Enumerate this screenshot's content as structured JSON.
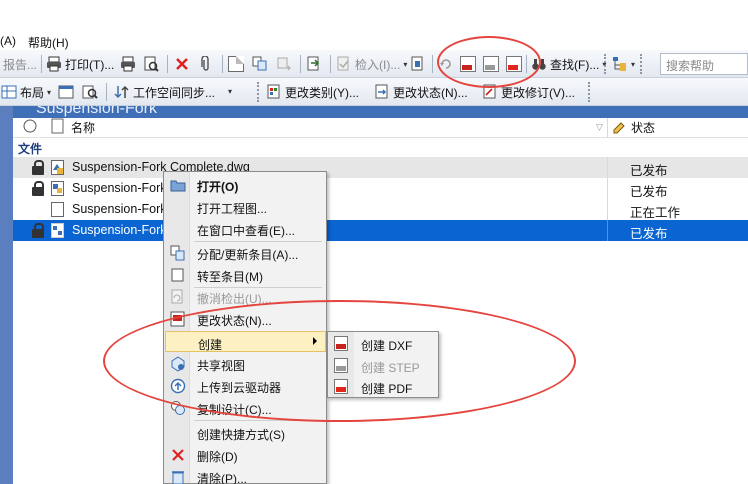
{
  "menubar": {
    "items": [
      "(A)",
      "帮助(H)"
    ]
  },
  "toolbar1": {
    "report_label": "报告...",
    "print_label": "打印(T)...",
    "checkin_label": "检入(I)...",
    "find_label": "查找(F)...",
    "search_placeholder": "搜索帮助"
  },
  "toolbar2": {
    "layout_label": "布局",
    "workspace_sync_label": "工作空间同步...",
    "change_category_label": "更改类别(Y)...",
    "change_state_label": "更改状态(N)...",
    "change_revision_label": "更改修订(V)..."
  },
  "title_strip_text": "Suspension-Fork",
  "columns": {
    "name": "名称",
    "state": "状态"
  },
  "group_label": "文件",
  "rows": [
    {
      "name": "Suspension-Fork Complete.dwg",
      "state": "已发布",
      "locked": true
    },
    {
      "name": "Suspension-Fork",
      "state": "已发布",
      "locked": true
    },
    {
      "name": "Suspension-Fork",
      "state": "正在工作",
      "locked": false
    },
    {
      "name": "Suspension-Fork",
      "state": "已发布",
      "locked": true
    }
  ],
  "context_menu": {
    "items": [
      {
        "label": "打开(O)"
      },
      {
        "label": "打开工程图..."
      },
      {
        "label": "在窗口中查看(E)..."
      },
      {
        "label": "分配/更新条目(A)..."
      },
      {
        "label": "转至条目(M)"
      },
      {
        "label": "撤消检出(U)..."
      },
      {
        "label": "更改状态(N)..."
      },
      {
        "label": "创建"
      },
      {
        "label": "共享视图"
      },
      {
        "label": "上传到云驱动器"
      },
      {
        "label": "复制设计(C)..."
      },
      {
        "label": "创建快捷方式(S)"
      },
      {
        "label": "删除(D)"
      },
      {
        "label": "清除(P)..."
      }
    ]
  },
  "submenu": {
    "items": [
      {
        "label": "创建 DXF"
      },
      {
        "label": "创建 STEP"
      },
      {
        "label": "创建 PDF"
      }
    ]
  },
  "colors": {
    "selection": "#0a64d2",
    "highlight": "#fdf0c2",
    "annotation": "#e4453e"
  }
}
